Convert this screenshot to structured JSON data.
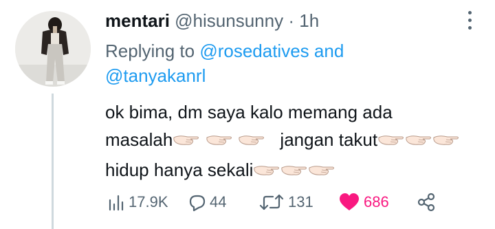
{
  "tweet": {
    "name": "mentari",
    "handle": "@hisunsunny",
    "separator": "·",
    "time": "1h",
    "replying_prefix": "Replying to",
    "reply_mention_1": "@rosedatives",
    "reply_conjunction": "and",
    "reply_mention_2": "@tanyakanrl",
    "text_line_1": "ok bima, dm saya kalo memang ada",
    "text_line_2a": "masalah",
    "text_line_2b": "jangan takut",
    "text_line_3": "hidup hanya sekali",
    "emoji_name": "backhand-index-pointing-left-light-skin-tone"
  },
  "actions": {
    "views": "17.9K",
    "replies": "44",
    "retweets": "131",
    "likes": "686"
  },
  "colors": {
    "text": "#0f1419",
    "secondary": "#536471",
    "link": "#1d9bf0",
    "like": "#f91880",
    "thread_line": "#cfd9de"
  }
}
